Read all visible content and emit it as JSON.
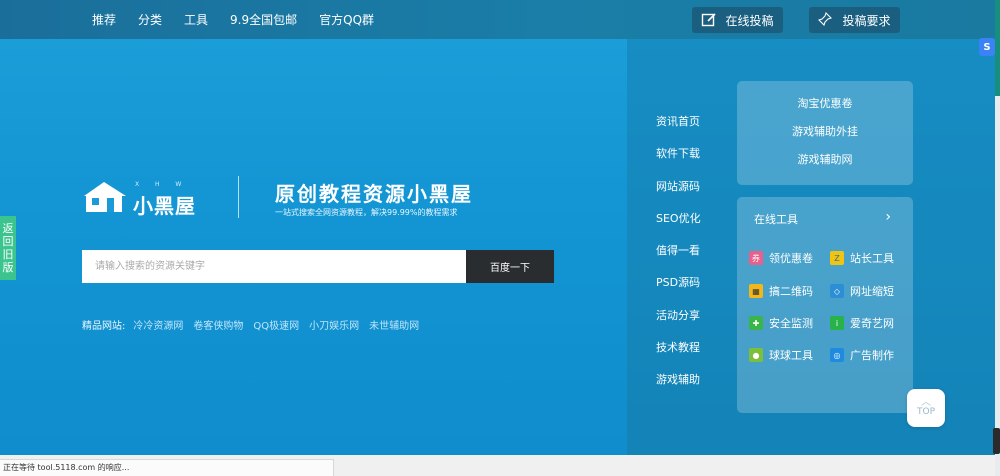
{
  "topnav": {
    "items": [
      "推荐",
      "分类",
      "工具",
      "9.9全国包邮",
      "官方QQ群"
    ],
    "submit_label": "在线投稿",
    "requirements_label": "投稿要求"
  },
  "hero": {
    "logo_text": "小黑屋",
    "logo_letters": "X H W",
    "title": "原创教程资源小黑屋",
    "subtitle": "一站式搜索全网资源教程，解决99.99%的教程需求",
    "search_placeholder": "请输入搜索的资源关键字",
    "search_button": "百度一下",
    "featured_label": "精品网站:",
    "featured_links": [
      "冷冷资源网",
      "卷客侠购物",
      "QQ极速网",
      "小刀娱乐网",
      "未世辅助网"
    ]
  },
  "sidenav": [
    "资讯首页",
    "软件下载",
    "网站源码",
    "SEO优化",
    "值得一看",
    "PSD源码",
    "活动分享",
    "技术教程",
    "游戏辅助"
  ],
  "card_links": [
    "淘宝优惠卷",
    "游戏辅助外挂",
    "游戏辅助网"
  ],
  "online_tools": {
    "heading": "在线工具",
    "tools": [
      {
        "label": "领优惠卷",
        "icon": "coupon-icon",
        "color": "#e8618c"
      },
      {
        "label": "站长工具",
        "icon": "webmaster-icon",
        "color": "#2a6fb0"
      },
      {
        "label": "搞二维码",
        "icon": "qrcode-icon",
        "color": "#f1b71c"
      },
      {
        "label": "网址缩短",
        "icon": "link-shorten-icon",
        "color": "#2c8fd6"
      },
      {
        "label": "安全监测",
        "icon": "security-icon",
        "color": "#3ab54a"
      },
      {
        "label": "爱奇艺网",
        "icon": "iqiyi-icon",
        "color": "#27b24a"
      },
      {
        "label": "球球工具",
        "icon": "ball-icon",
        "color": "#7bbf3a"
      },
      {
        "label": "广告制作",
        "icon": "ad-icon",
        "color": "#1f8be0"
      }
    ]
  },
  "back_tab": [
    "返",
    "回",
    "旧",
    "版"
  ],
  "float_top_label": "TOP",
  "float_s_label": "S",
  "status": "正在等待 tool.5118.com 的响应..."
}
